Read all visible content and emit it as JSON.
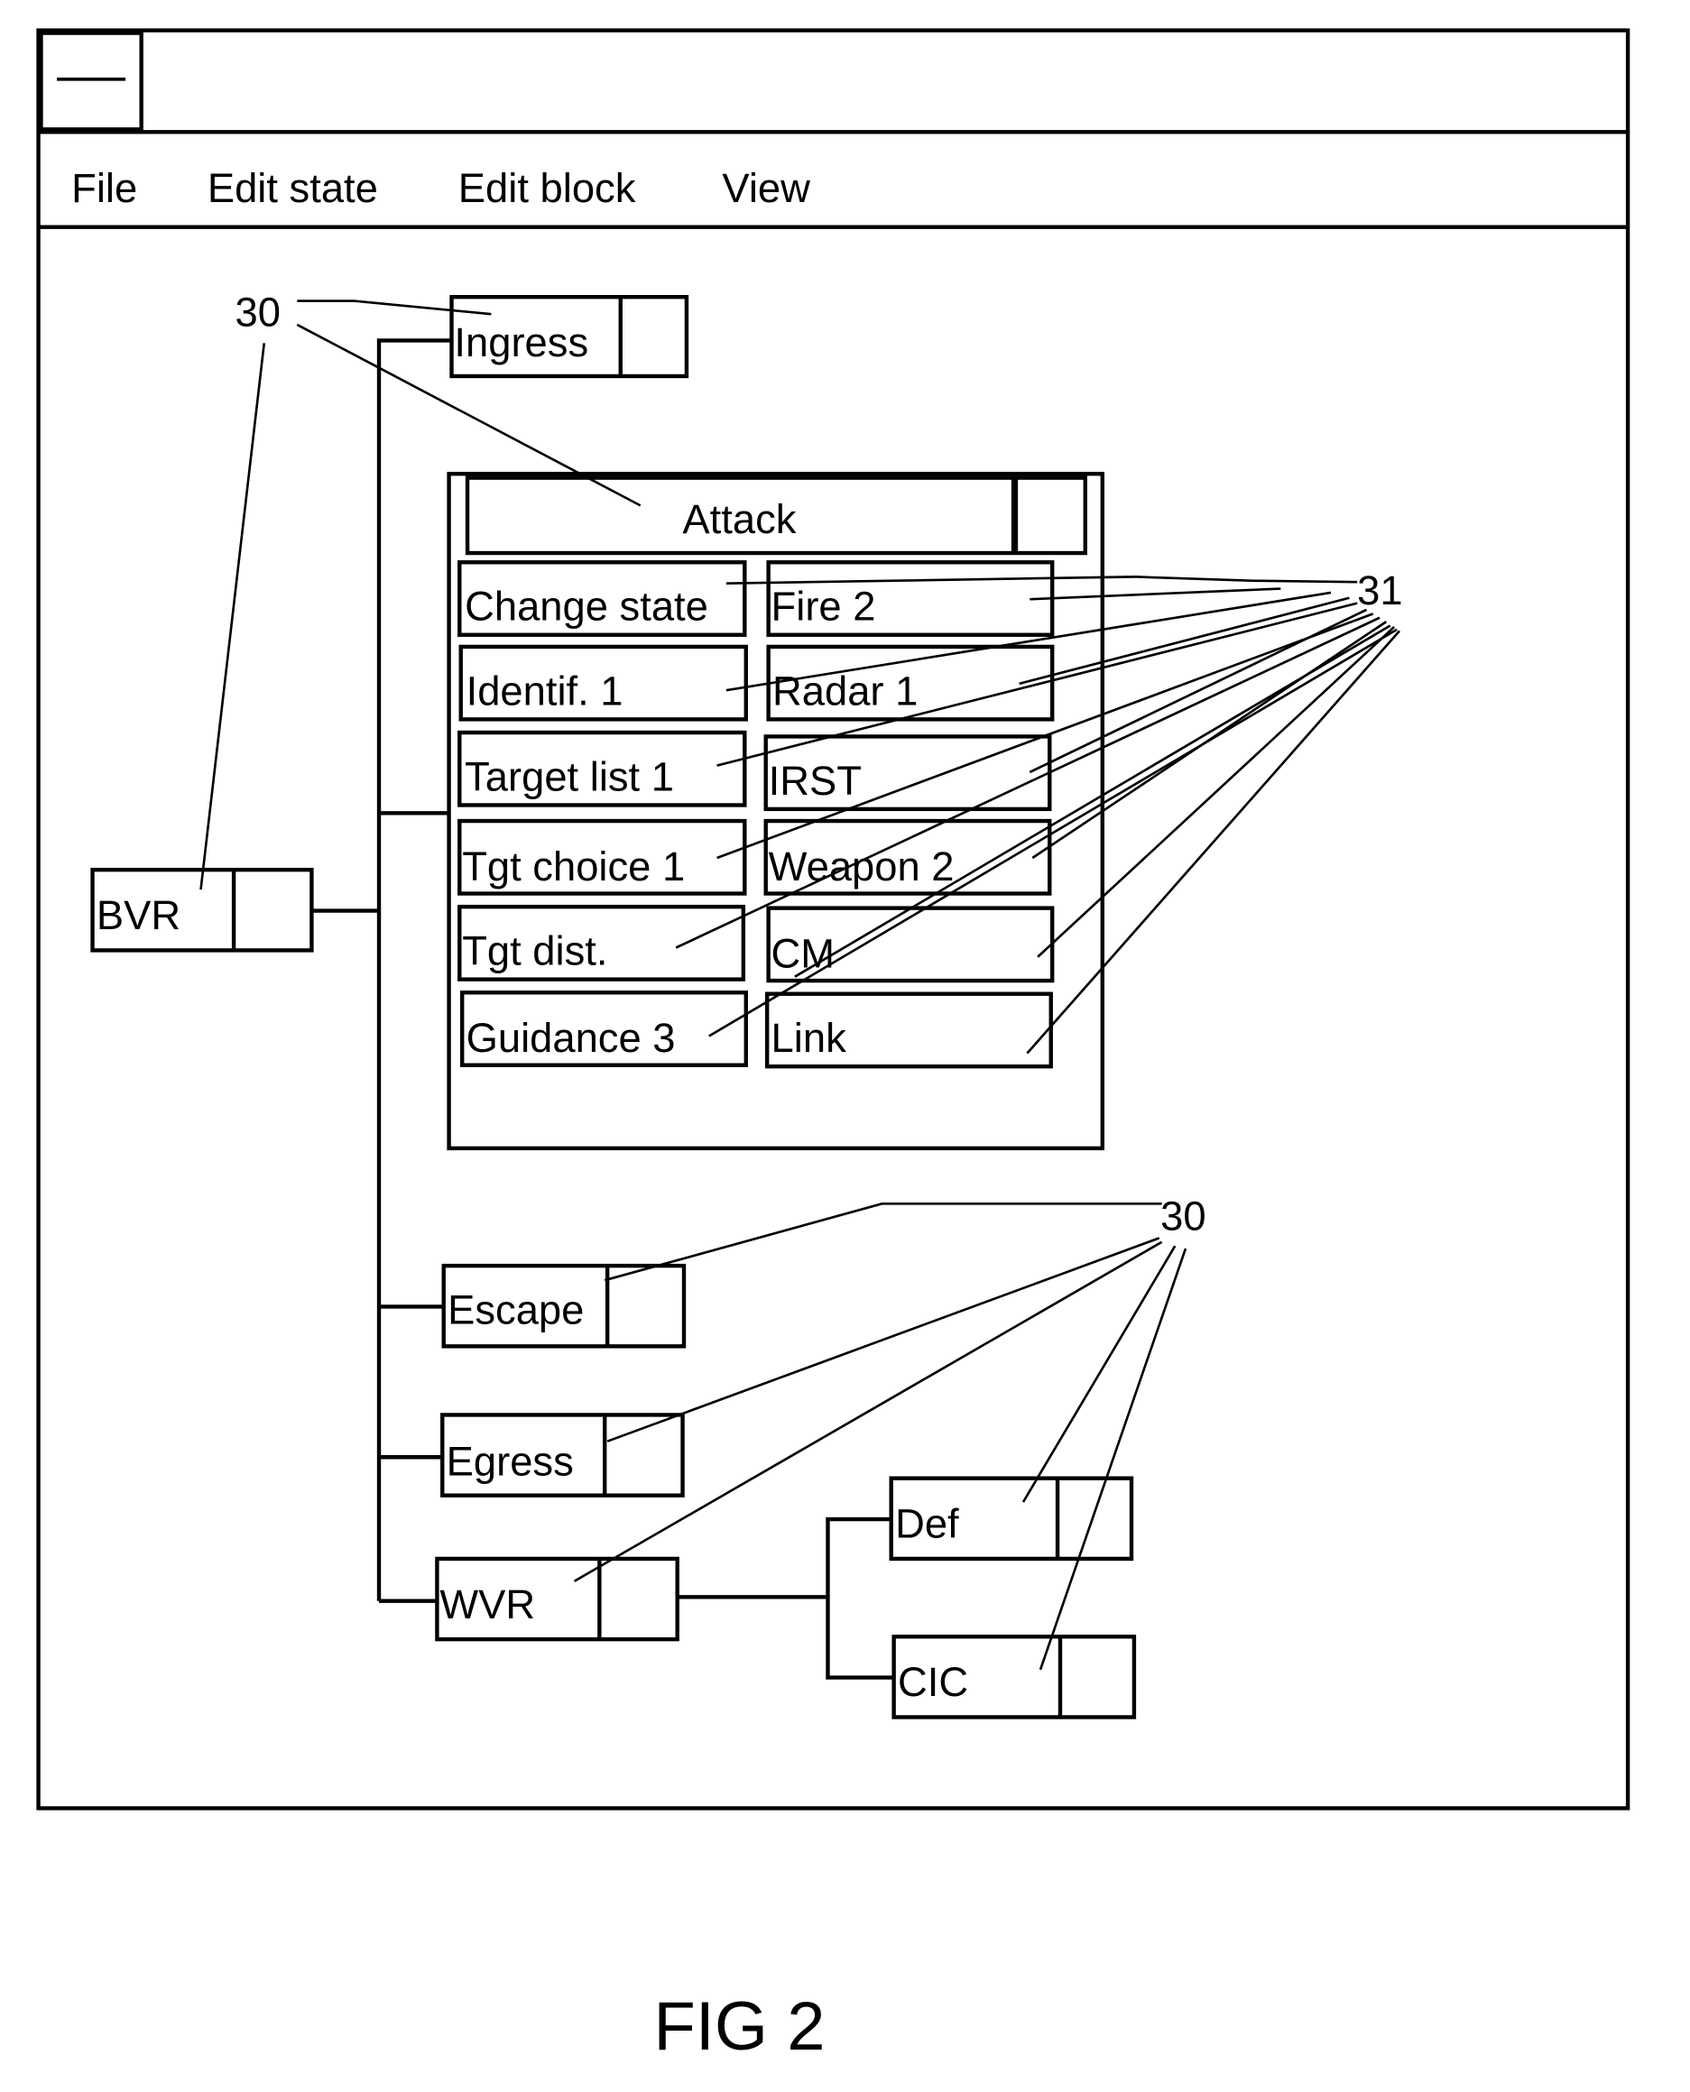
{
  "window": {
    "system_menu_icon": "minus-icon",
    "title": ""
  },
  "menu": {
    "items": [
      "File",
      "Edit state",
      "Edit block",
      "View"
    ]
  },
  "states": {
    "bvr": "BVR",
    "ingress": "Ingress",
    "attack": "Attack",
    "escape": "Escape",
    "egress": "Egress",
    "wvr": "WVR",
    "def": "Def",
    "cic": "CIC"
  },
  "attack_blocks": {
    "left": [
      "Change state",
      "Identif. 1",
      "Target list 1",
      "Tgt choice 1",
      "Tgt dist.",
      "Guidance 3"
    ],
    "right": [
      "Fire 2",
      "Radar 1",
      "IRST",
      "Weapon 2",
      "CM",
      "Link"
    ]
  },
  "reference_labels": {
    "states_top": "30",
    "blocks": "31",
    "states_bottom": "30"
  },
  "caption": "FIG 2"
}
